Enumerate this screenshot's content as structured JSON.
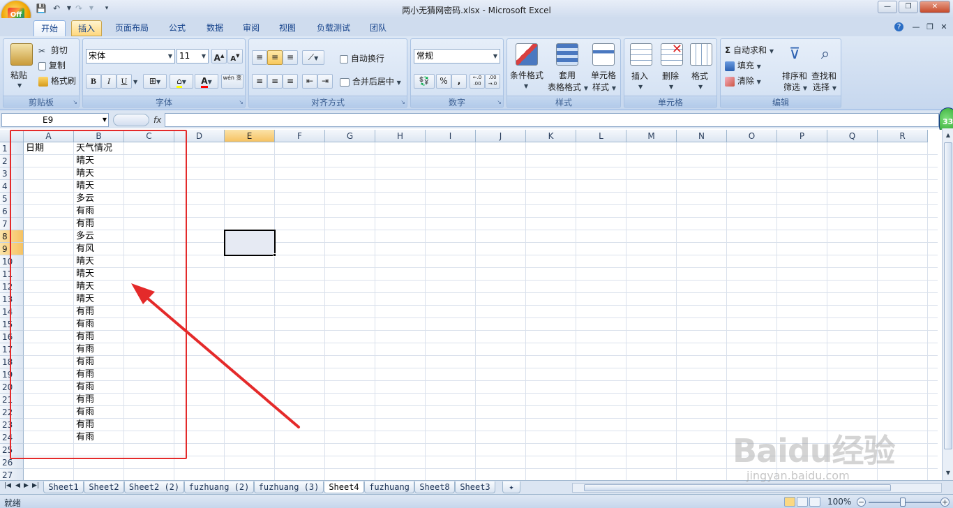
{
  "window": {
    "title": "两小无猜网密码.xlsx - Microsoft Excel",
    "office_logo": "Off"
  },
  "qat": {
    "save_icon": "save-icon",
    "undo_icon": "undo-icon",
    "redo_icon": "redo-icon"
  },
  "tabs": [
    "开始",
    "插入",
    "页面布局",
    "公式",
    "数据",
    "审阅",
    "视图",
    "负载测试",
    "团队"
  ],
  "active_tab": "开始",
  "ribbon": {
    "clipboard": {
      "label": "剪贴板",
      "paste": "粘贴",
      "cut": "剪切",
      "copy": "复制",
      "format_painter": "格式刷"
    },
    "font": {
      "label": "字体",
      "font_name": "宋体",
      "font_size": "11",
      "bold": "B",
      "italic": "I",
      "underline": "U",
      "grow": "A",
      "shrink": "A",
      "font_color": "A",
      "phonetic": "wén 变"
    },
    "alignment": {
      "label": "对齐方式",
      "wrap_text": "自动换行",
      "merge_center": "合并后居中"
    },
    "number": {
      "label": "数字",
      "format": "常规",
      "percent": "%",
      "comma": ",",
      "inc_decimal": "←.0 .00",
      "dec_decimal": ".00 →.0"
    },
    "styles": {
      "label": "样式",
      "conditional": "条件格式",
      "table_format_1": "套用",
      "table_format_2": "表格格式",
      "cell_styles_1": "单元格",
      "cell_styles_2": "样式"
    },
    "cells": {
      "label": "单元格",
      "insert": "插入",
      "delete": "删除",
      "format": "格式"
    },
    "editing": {
      "label": "编辑",
      "autosum": "自动求和",
      "fill": "填充",
      "clear": "清除",
      "sort_1": "排序和",
      "sort_2": "筛选",
      "find_1": "查找和",
      "find_2": "选择"
    }
  },
  "formula_bar": {
    "name_box": "E9",
    "fx": "fx",
    "content": ""
  },
  "columns": [
    "A",
    "B",
    "C",
    "D",
    "E",
    "F",
    "G",
    "H",
    "I",
    "J",
    "K",
    "L",
    "M",
    "N",
    "O",
    "P",
    "Q",
    "R"
  ],
  "selected_column": "E",
  "rows": [
    "1",
    "2",
    "3",
    "4",
    "5",
    "6",
    "7",
    "8",
    "9",
    "10",
    "11",
    "12",
    "13",
    "14",
    "15",
    "16",
    "17",
    "18",
    "19",
    "20",
    "21",
    "22",
    "23",
    "24",
    "25",
    "26",
    "27"
  ],
  "selected_rows": [
    "8",
    "9"
  ],
  "cells": {
    "A1": "日期",
    "B": [
      "天气情况",
      "晴天",
      "晴天",
      "晴天",
      "多云",
      "有雨",
      "有雨",
      "多云",
      "有风",
      "晴天",
      "晴天",
      "晴天",
      "晴天",
      "有雨",
      "有雨",
      "有雨",
      "有雨",
      "有雨",
      "有雨",
      "有雨",
      "有雨",
      "有雨",
      "有雨",
      "有雨"
    ]
  },
  "sheets": [
    "Sheet1",
    "Sheet2",
    "Sheet2 (2)",
    "fuzhuang (2)",
    "fuzhuang (3)",
    "Sheet4",
    "fuzhuang",
    "Sheet8",
    "Sheet3"
  ],
  "active_sheet": "Sheet4",
  "status": {
    "text": "就绪",
    "zoom": "100%"
  },
  "badge": "33",
  "watermark": {
    "brand": "Baidu经验",
    "url": "jingyan.baidu.com"
  },
  "colors": {
    "annotation_red": "#e42a2a",
    "ribbon_blue": "#d6e3f4",
    "header_selected": "#f6c262"
  }
}
